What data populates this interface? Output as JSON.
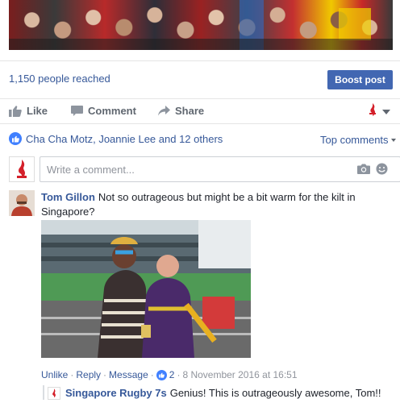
{
  "post": {
    "reach_text": "1,150 people reached",
    "boost_label": "Boost post"
  },
  "actions": {
    "like_label": "Like",
    "comment_label": "Comment",
    "share_label": "Share",
    "like_icon": "thumbs-up-icon",
    "comment_icon": "speech-bubble-icon",
    "share_icon": "share-arrow-icon"
  },
  "reactions": {
    "summary": "Cha Cha Motz, Joannie Lee and 12 others",
    "sort_label": "Top comments"
  },
  "composer": {
    "placeholder": "Write a comment..."
  },
  "comment": {
    "author": "Tom Gillon",
    "text": "Not so outrageous but might be a bit warm for the kilt in Singapore?",
    "unlike_label": "Unlike",
    "reply_label": "Reply",
    "message_label": "Message",
    "like_count": "2",
    "timestamp": "8 November 2016 at 16:51"
  },
  "reply": {
    "author": "Singapore Rugby 7s",
    "text": "Genius! This is outrageously awesome, Tom!!"
  },
  "colors": {
    "link": "#365899",
    "boost_bg": "#4267b2",
    "reaction_blue": "#4080ff",
    "muted": "#606770"
  }
}
